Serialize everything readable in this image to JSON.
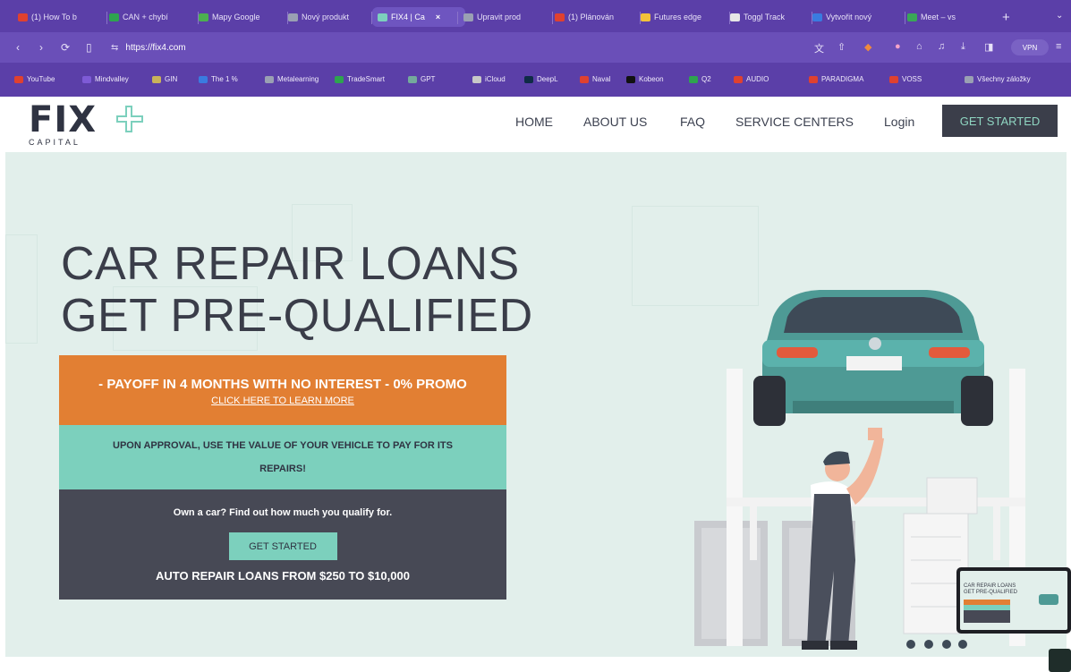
{
  "browser": {
    "tabs": [
      {
        "label": "(1) How To b",
        "fav": "#e0412f"
      },
      {
        "label": "CAN + chybí",
        "fav": "#2ea44f"
      },
      {
        "label": "Mapy Google",
        "fav": "#4caf50"
      },
      {
        "label": "Nový produkt",
        "fav": "#9aa0b3"
      },
      {
        "label": "FIX4 | Ca",
        "fav": "#7cd0bd",
        "active": true
      },
      {
        "label": "Upravit prod",
        "fav": "#9aa0b3"
      },
      {
        "label": "(1) Plánován",
        "fav": "#e0412f"
      },
      {
        "label": "Futures edge",
        "fav": "#f3c23a"
      },
      {
        "label": "Toggl Track",
        "fav": "#e6e6e6"
      },
      {
        "label": "Vytvořit nový",
        "fav": "#3a7be0"
      },
      {
        "label": "Meet – vs",
        "fav": "#3aa757"
      }
    ],
    "url": "https://fix4.com",
    "vpn_label": "VPN",
    "bookmarks": [
      {
        "label": "YouTube",
        "fav": "#e0412f"
      },
      {
        "label": "Mindvalley",
        "fav": "#7e5bd6"
      },
      {
        "label": "GIN",
        "fav": "#c9b25a"
      },
      {
        "label": "The 1 %",
        "fav": "#3a7be0"
      },
      {
        "label": "Metalearning",
        "fav": "#9aa0b3"
      },
      {
        "label": "TradeSmart",
        "fav": "#2ea44f"
      },
      {
        "label": "GPT",
        "fav": "#74aa9c"
      },
      {
        "label": "iCloud",
        "fav": "#c8c8c8"
      },
      {
        "label": "DeepL",
        "fav": "#0f2b46"
      },
      {
        "label": "Naval",
        "fav": "#e0412f"
      },
      {
        "label": "Kobeon",
        "fav": "#111111"
      },
      {
        "label": "Q2",
        "fav": "#2ea44f"
      },
      {
        "label": "AUDIO",
        "fav": "#e0412f"
      },
      {
        "label": "PARADIGMA",
        "fav": "#e0412f"
      },
      {
        "label": "VOSS",
        "fav": "#e0412f"
      },
      {
        "label": "Všechny záložky",
        "fav": "#9aa0b3"
      }
    ]
  },
  "site": {
    "logo": "FIX",
    "logo_sub": "CAPITAL",
    "nav": [
      "HOME",
      "ABOUT US",
      "FAQ",
      "SERVICE CENTERS",
      "Login"
    ],
    "cta_top": "GET STARTED",
    "hero": {
      "title_line1": "CAR REPAIR LOANS",
      "title_line2": "GET PRE-QUALIFIED",
      "promo_text": "- PAYOFF IN 4 MONTHS WITH NO INTEREST - 0% PROMO",
      "promo_link": "CLICK HERE TO LEARN MORE",
      "approval_text": "UPON APPROVAL, USE THE VALUE OF YOUR VEHICLE TO PAY FOR ITS REPAIRS!",
      "qualify_question": "Own a car? Find out how much you qualify for.",
      "qualify_button": "GET STARTED",
      "loan_range": "AUTO REPAIR LOANS FROM $250 TO $10,000"
    },
    "preview": {
      "line1": "CAR REPAIR LOANS",
      "line2": "GET PRE-QUALIFIED"
    },
    "colors": {
      "orange": "#e27f33",
      "teal": "#7cd0bd",
      "dark": "#474955",
      "hero_bg": "#e2efeb"
    }
  }
}
